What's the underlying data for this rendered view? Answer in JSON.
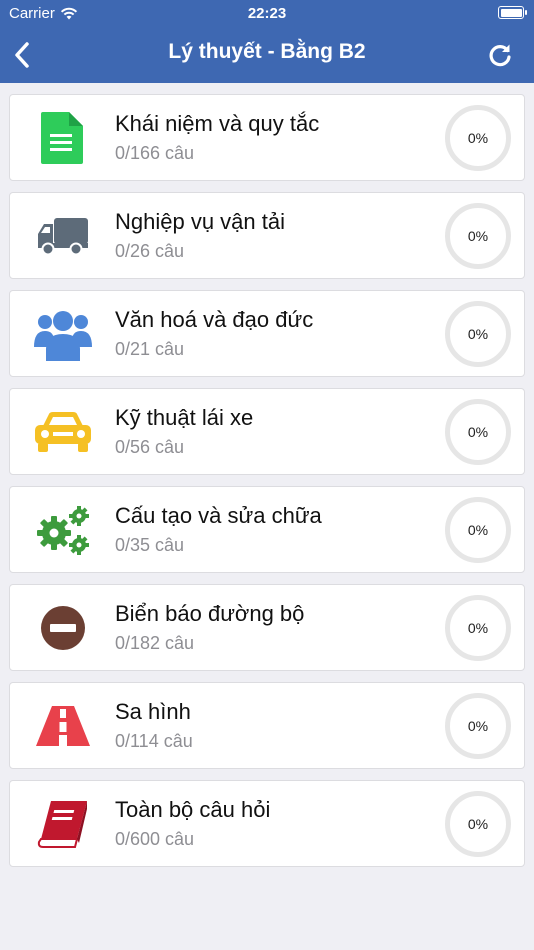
{
  "status_bar": {
    "carrier": "Carrier",
    "time": "22:23"
  },
  "header": {
    "title": "Lý thuyết - Bằng B2"
  },
  "colors": {
    "header": "#3e68b2",
    "doc": "#2ecc5a",
    "truck": "#5d6b79",
    "people": "#4e87d8",
    "car": "#f5c024",
    "gears": "#3d9b3d",
    "sign": "#6b3f33",
    "road": "#e8414b",
    "book": "#c0182e"
  },
  "categories": [
    {
      "icon": "document-icon",
      "label": "Khái niệm và quy tắc",
      "count": "0/166 câu",
      "progress": "0%"
    },
    {
      "icon": "truck-icon",
      "label": "Nghiệp vụ vận tải",
      "count": "0/26 câu",
      "progress": "0%"
    },
    {
      "icon": "people-icon",
      "label": "Văn hoá và đạo đức",
      "count": "0/21 câu",
      "progress": "0%"
    },
    {
      "icon": "car-icon",
      "label": "Kỹ thuật lái xe",
      "count": "0/56 câu",
      "progress": "0%"
    },
    {
      "icon": "gears-icon",
      "label": "Cấu tạo và sửa chữa",
      "count": "0/35 câu",
      "progress": "0%"
    },
    {
      "icon": "no-entry-sign-icon",
      "label": "Biển báo đường bộ",
      "count": "0/182 câu",
      "progress": "0%"
    },
    {
      "icon": "road-icon",
      "label": "Sa hình",
      "count": "0/114 câu",
      "progress": "0%"
    },
    {
      "icon": "book-icon",
      "label": "Toàn bộ câu hỏi",
      "count": "0/600 câu",
      "progress": "0%"
    }
  ]
}
